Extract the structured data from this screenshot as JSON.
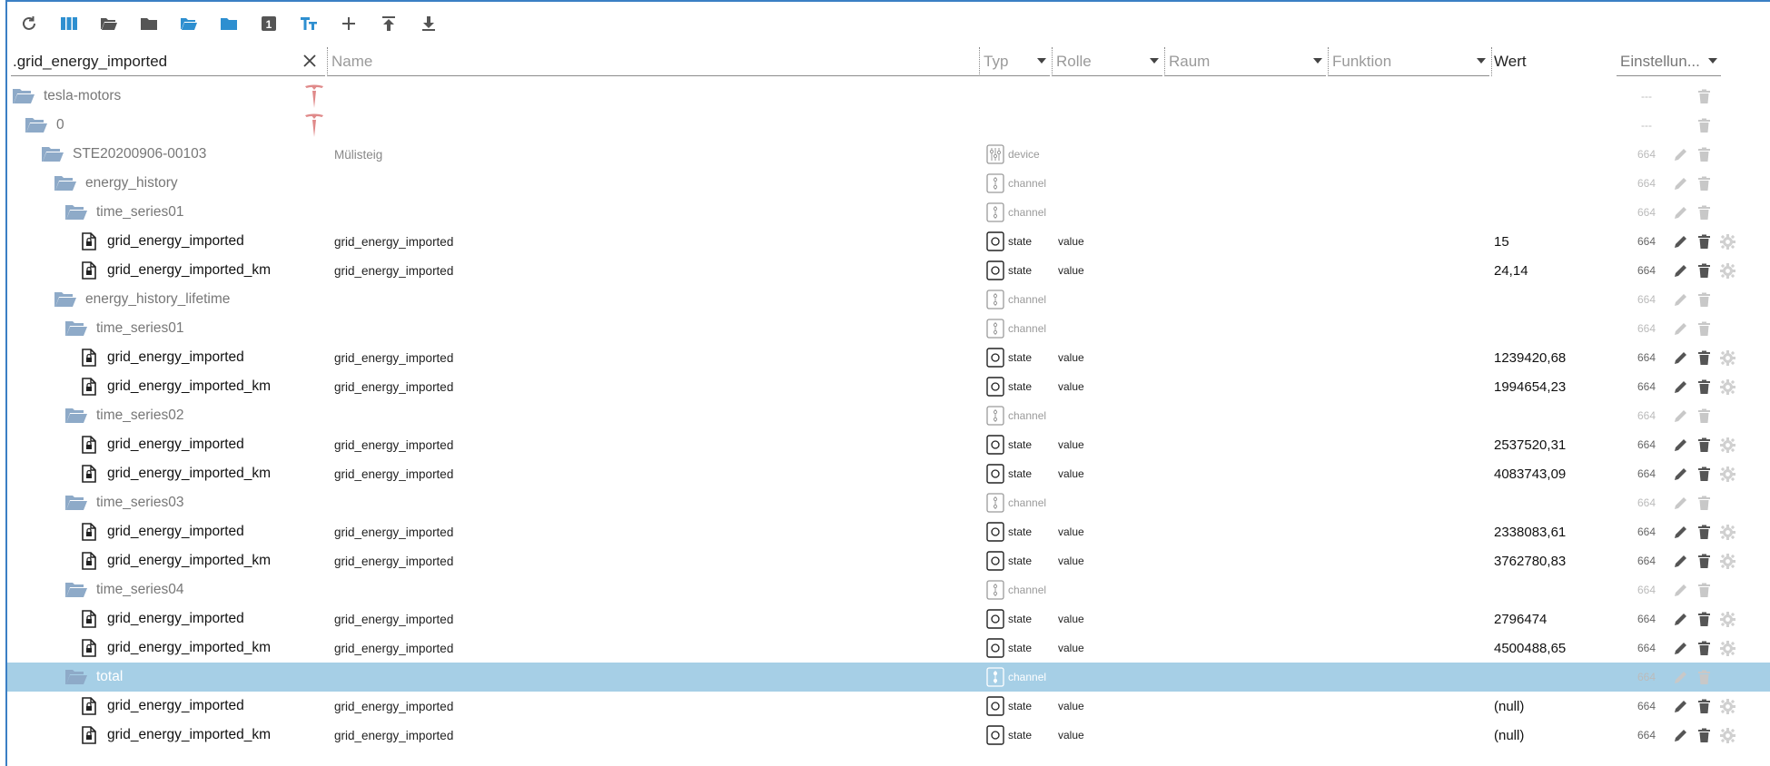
{
  "colors": {
    "accent": "#2e8fd0",
    "folder": "#8eaac8",
    "selected_row": "#a6cfe6",
    "tesla_red": "#e08a8a",
    "action_dark": "#555555",
    "action_light": "#c8c8c8"
  },
  "toolbar": {
    "buttons": [
      {
        "icon": "refresh-icon"
      },
      {
        "icon": "columns-icon"
      },
      {
        "icon": "folder-open-icon"
      },
      {
        "icon": "folder-closed-icon"
      },
      {
        "icon": "expand-all-icon"
      },
      {
        "icon": "collapse-all-icon"
      },
      {
        "icon": "number-toggle-icon",
        "label": "1"
      },
      {
        "icon": "text-size-icon",
        "label": "TT"
      },
      {
        "icon": "plus-icon"
      },
      {
        "icon": "upload-icon"
      },
      {
        "icon": "download-icon"
      }
    ]
  },
  "header": {
    "id_filter": ".grid_energy_imported",
    "name_placeholder": "Name",
    "type_placeholder": "Typ",
    "role_placeholder": "Rolle",
    "room_placeholder": "Raum",
    "function_placeholder": "Funktion",
    "value_label": "Wert",
    "settings_label": "Einstellun..."
  },
  "rows": [
    {
      "kind": "folder",
      "depth": 0,
      "label": "tesla-motors",
      "tesla": true,
      "acc": "---",
      "acts": "del"
    },
    {
      "kind": "folder",
      "depth": 1,
      "label": "0",
      "tesla": true,
      "acc": "---",
      "acts": "del"
    },
    {
      "kind": "folder",
      "depth": 2,
      "label": "STE20200906-00103",
      "name": "Mülisteig",
      "type": "device",
      "acc": "664",
      "acts": "edit-del"
    },
    {
      "kind": "folder",
      "depth": 3,
      "label": "energy_history",
      "type": "channel",
      "acc": "664",
      "acts": "edit-del"
    },
    {
      "kind": "folder",
      "depth": 4,
      "label": "time_series01",
      "type": "channel",
      "acc": "664",
      "acts": "edit-del"
    },
    {
      "kind": "state",
      "depth": 5,
      "label": "grid_energy_imported",
      "name": "grid_energy_imported",
      "type": "state",
      "role": "value",
      "value": "15",
      "acc": "664"
    },
    {
      "kind": "state",
      "depth": 5,
      "label": "grid_energy_imported_km",
      "name": "grid_energy_imported",
      "type": "state",
      "role": "value",
      "value": "24,14",
      "acc": "664"
    },
    {
      "kind": "folder",
      "depth": 3,
      "label": "energy_history_lifetime",
      "type": "channel",
      "acc": "664",
      "acts": "edit-del"
    },
    {
      "kind": "folder",
      "depth": 4,
      "label": "time_series01",
      "type": "channel",
      "acc": "664",
      "acts": "edit-del"
    },
    {
      "kind": "state",
      "depth": 5,
      "label": "grid_energy_imported",
      "name": "grid_energy_imported",
      "type": "state",
      "role": "value",
      "value": "1239420,68",
      "acc": "664"
    },
    {
      "kind": "state",
      "depth": 5,
      "label": "grid_energy_imported_km",
      "name": "grid_energy_imported",
      "type": "state",
      "role": "value",
      "value": "1994654,23",
      "acc": "664"
    },
    {
      "kind": "folder",
      "depth": 4,
      "label": "time_series02",
      "type": "channel",
      "acc": "664",
      "acts": "edit-del"
    },
    {
      "kind": "state",
      "depth": 5,
      "label": "grid_energy_imported",
      "name": "grid_energy_imported",
      "type": "state",
      "role": "value",
      "value": "2537520,31",
      "acc": "664"
    },
    {
      "kind": "state",
      "depth": 5,
      "label": "grid_energy_imported_km",
      "name": "grid_energy_imported",
      "type": "state",
      "role": "value",
      "value": "4083743,09",
      "acc": "664"
    },
    {
      "kind": "folder",
      "depth": 4,
      "label": "time_series03",
      "type": "channel",
      "acc": "664",
      "acts": "edit-del"
    },
    {
      "kind": "state",
      "depth": 5,
      "label": "grid_energy_imported",
      "name": "grid_energy_imported",
      "type": "state",
      "role": "value",
      "value": "2338083,61",
      "acc": "664"
    },
    {
      "kind": "state",
      "depth": 5,
      "label": "grid_energy_imported_km",
      "name": "grid_energy_imported",
      "type": "state",
      "role": "value",
      "value": "3762780,83",
      "acc": "664"
    },
    {
      "kind": "folder",
      "depth": 4,
      "label": "time_series04",
      "type": "channel",
      "acc": "664",
      "acts": "edit-del"
    },
    {
      "kind": "state",
      "depth": 5,
      "label": "grid_energy_imported",
      "name": "grid_energy_imported",
      "type": "state",
      "role": "value",
      "value": "2796474",
      "acc": "664"
    },
    {
      "kind": "state",
      "depth": 5,
      "label": "grid_energy_imported_km",
      "name": "grid_energy_imported",
      "type": "state",
      "role": "value",
      "value": "4500488,65",
      "acc": "664"
    },
    {
      "kind": "folder",
      "depth": 4,
      "label": "total",
      "type": "channel",
      "acc": "664",
      "acts": "edit-del",
      "selected": true
    },
    {
      "kind": "state",
      "depth": 5,
      "label": "grid_energy_imported",
      "name": "grid_energy_imported",
      "type": "state",
      "role": "value",
      "value": "(null)",
      "acc": "664"
    },
    {
      "kind": "state",
      "depth": 5,
      "label": "grid_energy_imported_km",
      "name": "grid_energy_imported",
      "type": "state",
      "role": "value",
      "value": "(null)",
      "acc": "664"
    }
  ]
}
